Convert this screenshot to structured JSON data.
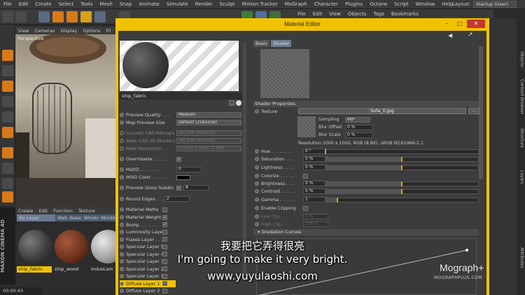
{
  "menubar": {
    "items": [
      "File",
      "Edit",
      "Create",
      "Select",
      "Tools",
      "Mesh",
      "Snap",
      "Animate",
      "Simulate",
      "Render",
      "Sculpt",
      "Motion Tracker",
      "MoGraph",
      "Character",
      "Plugins",
      "Octane",
      "Script",
      "Window",
      "Help"
    ],
    "layout_label": "Layout:",
    "layout_value": "Startup (User)"
  },
  "right_menubar": {
    "items": [
      "File",
      "Edit",
      "View",
      "Objects",
      "Tags",
      "Bookmarks"
    ]
  },
  "viewport": {
    "menu": [
      "View",
      "Cameras",
      "Display",
      "Options",
      "Fil"
    ],
    "label": "Perspective"
  },
  "material_manager": {
    "menu": [
      "Create",
      "Edit",
      "Function",
      "Texture"
    ],
    "filters": [
      "No Layer",
      "Wall, Base, Windows,...",
      "Windows"
    ],
    "materials": [
      {
        "name": "ship_fabric",
        "selected": true
      },
      {
        "name": "ship_wood",
        "selected": false
      },
      {
        "name": "IndusLam",
        "selected": false
      }
    ],
    "timecode": "00:00:43"
  },
  "logo": "MAXON CINEMA 4D",
  "material_editor": {
    "title": "Material Editor",
    "material_name": "ship_fabric",
    "settings": [
      {
        "label": "Preview Quality . . .",
        "value": "Medium",
        "type": "dropdown",
        "dim": false
      },
      {
        "label": "Map Preview Size",
        "value": "Default (256x256)",
        "type": "dropdown",
        "dim": false
      },
      {
        "label": "Convert CAD Bitmaps",
        "value": "Yes (Per Material)",
        "type": "dropdown",
        "dim": true
      },
      {
        "label": "Bake CAD 2D Shaders",
        "value": "Yes (Per Material)",
        "type": "dropdown",
        "dim": true
      },
      {
        "label": "Bake Resolution . .",
        "value": "512x512 1600 (2 MB)",
        "type": "dropdown",
        "dim": true
      },
      {
        "label": "Overridable . . . . .",
        "value": "✓",
        "type": "check",
        "dim": false
      },
      {
        "label": "MatID . . . . . . . .",
        "value": "0",
        "type": "number",
        "dim": false
      },
      {
        "label": "MSID Color . . . . .",
        "value": "",
        "type": "swatch",
        "dim": false
      },
      {
        "label": "Preview Gloss Subdiv",
        "value": "8",
        "type": "number",
        "dim": false
      },
      {
        "label": "Round Edges . . . .",
        "value": "2",
        "type": "number",
        "dim": false
      }
    ],
    "channels": [
      {
        "label": "Material Matte",
        "checked": false
      },
      {
        "label": "Material Weight",
        "checked": true
      },
      {
        "label": "Bump . . . . . . .",
        "checked": true
      },
      {
        "label": "Luminosity Layer",
        "checked": false
      },
      {
        "label": "Flakes Layer . . .",
        "checked": false
      },
      {
        "label": "Specular Layer 5",
        "checked": false
      },
      {
        "label": "Specular Layer 4",
        "checked": false
      },
      {
        "label": "Specular Layer 3",
        "checked": false
      },
      {
        "label": "Specular Layer 2",
        "checked": false
      },
      {
        "label": "Specular Layer 1",
        "checked": false
      },
      {
        "label": "Diffuse Layer 1",
        "checked": true,
        "selected": true
      },
      {
        "label": "Diffuse Layer 2",
        "checked": false
      }
    ],
    "tabs": [
      "Basic",
      "Shader"
    ],
    "shader_properties_title": "Shader Properties",
    "texture_label": "Texture",
    "texture_file": "Sofa_0.jpg",
    "sampling": {
      "label": "Sampling",
      "value": "MIP"
    },
    "blur_offset": {
      "label": "Blur Offset",
      "value": "0 %"
    },
    "blur_scale": {
      "label": "Blur Scale",
      "value": "0 %"
    },
    "resolution_text": "Resolution 1000 x 1000, RGB (8 Bit), sRGB IEC61966-2.1",
    "adjustments": [
      {
        "label": "Hue . . . . . . .",
        "value": "0 °",
        "percent": 0.0,
        "dim": false
      },
      {
        "label": "Saturation . . .",
        "value": "0 %",
        "percent": 0.5,
        "dim": false
      },
      {
        "label": "Lightness . . . .",
        "value": "0 %",
        "percent": 0.5,
        "dim": false
      },
      {
        "label": "Colorize . . . . .",
        "value": "",
        "percent": null,
        "dim": false
      },
      {
        "label": "Brightness . . .",
        "value": "0 %",
        "percent": 0.5,
        "dim": false
      },
      {
        "label": "Contrast . . . . .",
        "value": "0 %",
        "percent": 0.5,
        "dim": false
      },
      {
        "label": "Gamma . . . . . .",
        "value": "1",
        "percent": 0.08,
        "dim": false
      },
      {
        "label": "Enable Clipping",
        "value": "",
        "percent": null,
        "dim": false
      },
      {
        "label": "Low Clip . . . .",
        "value": "0 %",
        "percent": null,
        "dim": true
      },
      {
        "label": "High Clip . . . .",
        "value": "100 %",
        "percent": null,
        "dim": true
      }
    ],
    "gradation_curves": "Gradation Curves"
  },
  "right_side_tabs": [
    "Objects",
    "Content Browser",
    "Structure",
    "Layers",
    "Attributes"
  ],
  "subtitles": {
    "chinese": "我要把它弄得很亮",
    "english": "I'm going to make it very bright.",
    "url": "www.yuyulaoshi.com"
  },
  "watermark": {
    "brand": "Mograph+",
    "url": "MOGRAPHPLUS.COM"
  },
  "colors": {
    "accent_yellow": "#f0c200",
    "close_red": "#c7382d",
    "slider_knob": "#e8a000"
  }
}
